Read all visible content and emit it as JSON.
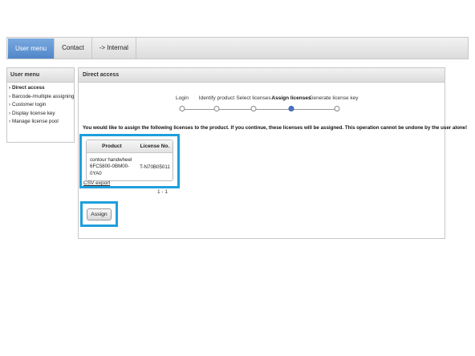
{
  "topnav": {
    "tabs": [
      {
        "label": "User menu",
        "active": true
      },
      {
        "label": "Contact",
        "active": false
      },
      {
        "label": "-> Internal",
        "active": false
      }
    ]
  },
  "sidebar": {
    "title": "User menu",
    "items": [
      {
        "label": "Direct access",
        "active": true
      },
      {
        "label": "Barcode-/multiple assigning",
        "active": false
      },
      {
        "label": "Customer login",
        "active": false
      },
      {
        "label": "Display license key",
        "active": false
      },
      {
        "label": "Manage license pool",
        "active": false
      }
    ]
  },
  "main": {
    "title": "Direct access",
    "steps": [
      {
        "label": "Login",
        "current": false
      },
      {
        "label": "Identify product",
        "current": false
      },
      {
        "label": "Select licenses",
        "current": false
      },
      {
        "label": "Assign licenses",
        "current": true
      },
      {
        "label": "Generate license key",
        "current": false
      }
    ],
    "notice": "You would like to assign the following licenses to the product. If you continue, these licenses will be assigned. This operation cannot be undone by the user alone!",
    "table": {
      "headers": [
        "Product",
        "License No."
      ],
      "rows": [
        {
          "product_line1": "contour handwheel",
          "product_line2": "6FC5800-0BM00-0YA0",
          "license": "T-N70B05011"
        }
      ]
    },
    "csv_label": "CSV export",
    "paging": "1 - 1",
    "assign_label": "Assign"
  },
  "colors": {
    "highlight": "#1ea0dc",
    "active_tab": "#5a8fd0",
    "current_step": "#4a74c6"
  }
}
